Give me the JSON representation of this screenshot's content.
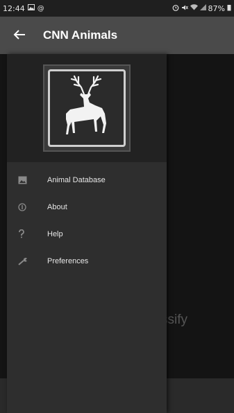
{
  "status_bar": {
    "time": "12:44",
    "battery": "87%"
  },
  "app_bar": {
    "title": "CNN Animals"
  },
  "drawer": {
    "items": [
      {
        "label": "Animal Database",
        "icon": "image-icon"
      },
      {
        "label": "About",
        "icon": "info-icon"
      },
      {
        "label": "Help",
        "icon": "question-icon"
      },
      {
        "label": "Preferences",
        "icon": "wrench-icon"
      }
    ]
  },
  "content": {
    "classify_text": "ssify"
  }
}
